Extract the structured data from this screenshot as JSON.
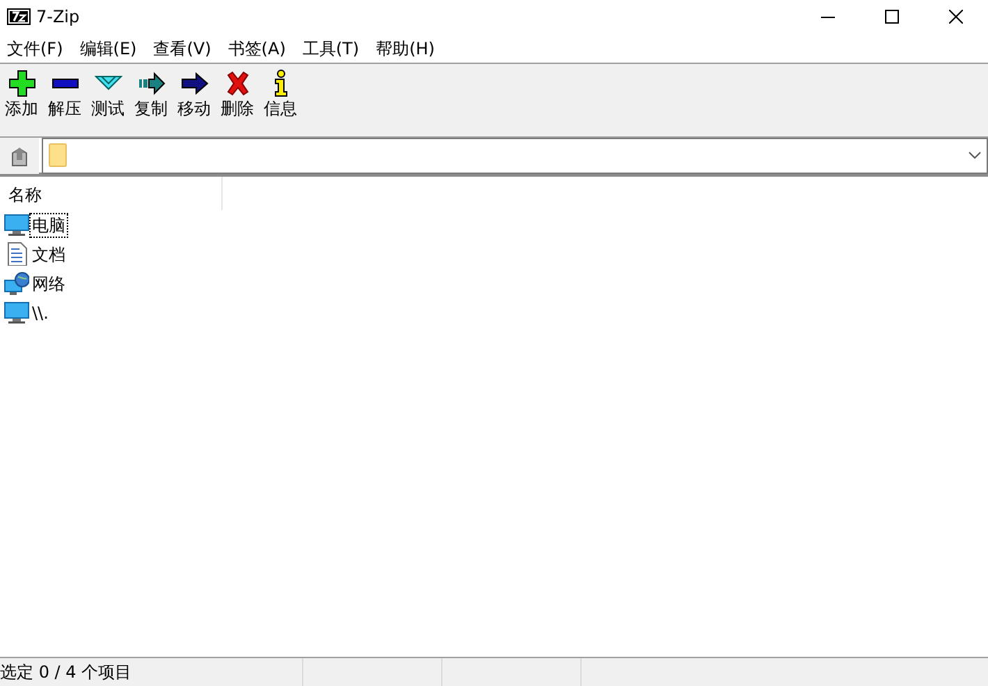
{
  "window": {
    "title": "7-Zip"
  },
  "menu": [
    "文件(F)",
    "编辑(E)",
    "查看(V)",
    "书签(A)",
    "工具(T)",
    "帮助(H)"
  ],
  "toolbar": [
    {
      "kind": "add",
      "label": "添加"
    },
    {
      "kind": "extract",
      "label": "解压"
    },
    {
      "kind": "test",
      "label": "测试"
    },
    {
      "kind": "copy",
      "label": "复制"
    },
    {
      "kind": "move",
      "label": "移动"
    },
    {
      "kind": "delete",
      "label": "删除"
    },
    {
      "kind": "info",
      "label": "信息"
    }
  ],
  "table": {
    "columns": [
      "名称"
    ],
    "rows": [
      {
        "kind": "computer",
        "name": "电脑",
        "selected": true
      },
      {
        "kind": "document",
        "name": "文档",
        "selected": false
      },
      {
        "kind": "network",
        "name": "网络",
        "selected": false
      },
      {
        "kind": "computer",
        "name": "\\\\.",
        "selected": false
      }
    ]
  },
  "status_bar": {
    "text": "选定 0 / 4 个项目"
  }
}
